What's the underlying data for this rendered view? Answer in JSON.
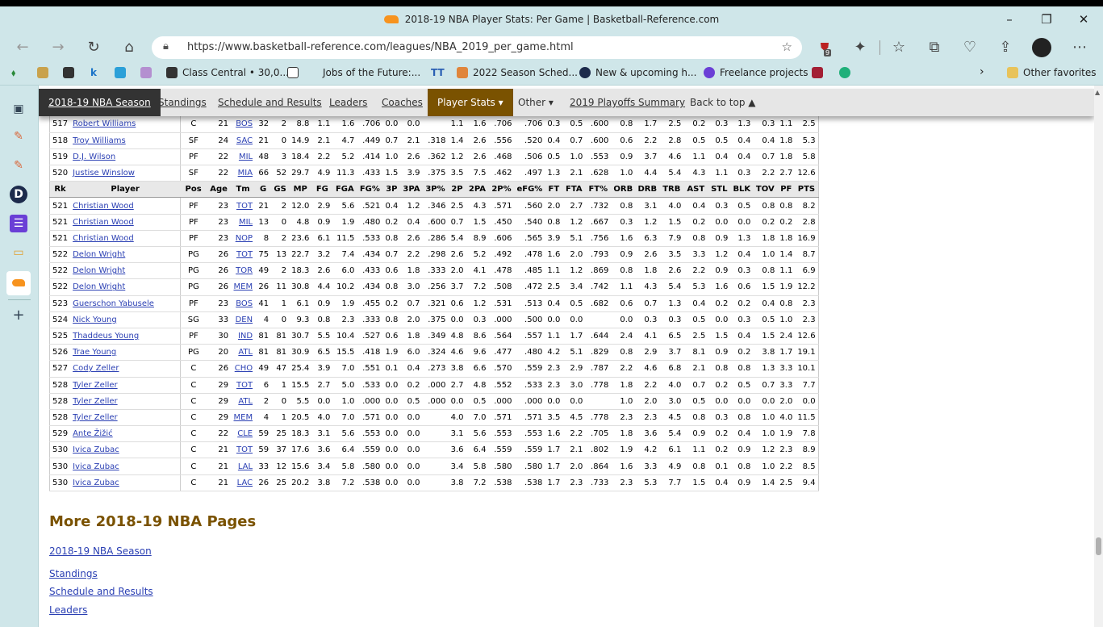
{
  "window": {
    "title": "2018-19 NBA Player Stats: Per Game | Basketball-Reference.com"
  },
  "browser": {
    "url": "https://www.basketball-reference.com/leagues/NBA_2019_per_game.html",
    "extension_badge": "9",
    "bookmarks": [
      {
        "label": "Class Central • 30,0...",
        "icon": "class-central-icon"
      },
      {
        "label": "Jobs of the Future:...",
        "icon": "document-icon"
      },
      {
        "label": "2022 Season Sched...",
        "icon": "pencil-icon"
      },
      {
        "label": "New & upcoming h...",
        "icon": "d-logo-icon"
      },
      {
        "label": "Freelance projects",
        "icon": "freelance-icon"
      }
    ],
    "other_favorites": "Other favorites"
  },
  "site_nav": {
    "items": [
      {
        "label": "2018-19 NBA Season"
      },
      {
        "label": "Standings"
      },
      {
        "label": "Schedule and Results"
      },
      {
        "label": "Leaders"
      },
      {
        "label": "Coaches"
      },
      {
        "label": "Player Stats ▾"
      },
      {
        "label": "Other ▾"
      },
      {
        "label": "2019 Playoffs Summary"
      },
      {
        "label": "Back to top ▲"
      }
    ]
  },
  "table": {
    "headers": [
      "Rk",
      "Player",
      "Pos",
      "Age",
      "Tm",
      "G",
      "GS",
      "MP",
      "FG",
      "FGA",
      "FG%",
      "3P",
      "3PA",
      "3P%",
      "2P",
      "2PA",
      "2P%",
      "eFG%",
      "FT",
      "FTA",
      "FT%",
      "ORB",
      "DRB",
      "TRB",
      "AST",
      "STL",
      "BLK",
      "TOV",
      "PF",
      "PTS"
    ],
    "rows_top": [
      [
        "517",
        "Robert Williams",
        "C",
        "21",
        "BOS",
        "32",
        "2",
        "8.8",
        "1.1",
        "1.6",
        ".706",
        "0.0",
        "0.0",
        "",
        "1.1",
        "1.6",
        ".706",
        ".706",
        "0.3",
        "0.5",
        ".600",
        "0.8",
        "1.7",
        "2.5",
        "0.2",
        "0.3",
        "1.3",
        "0.3",
        "1.1",
        "2.5"
      ],
      [
        "518",
        "Troy Williams",
        "SF",
        "24",
        "SAC",
        "21",
        "0",
        "14.9",
        "2.1",
        "4.7",
        ".449",
        "0.7",
        "2.1",
        ".318",
        "1.4",
        "2.6",
        ".556",
        ".520",
        "0.4",
        "0.7",
        ".600",
        "0.6",
        "2.2",
        "2.8",
        "0.5",
        "0.5",
        "0.4",
        "0.4",
        "1.8",
        "5.3"
      ],
      [
        "519",
        "D.J. Wilson",
        "PF",
        "22",
        "MIL",
        "48",
        "3",
        "18.4",
        "2.2",
        "5.2",
        ".414",
        "1.0",
        "2.6",
        ".362",
        "1.2",
        "2.6",
        ".468",
        ".506",
        "0.5",
        "1.0",
        ".553",
        "0.9",
        "3.7",
        "4.6",
        "1.1",
        "0.4",
        "0.4",
        "0.7",
        "1.8",
        "5.8"
      ],
      [
        "520",
        "Justise Winslow",
        "SF",
        "22",
        "MIA",
        "66",
        "52",
        "29.7",
        "4.9",
        "11.3",
        ".433",
        "1.5",
        "3.9",
        ".375",
        "3.5",
        "7.5",
        ".462",
        ".497",
        "1.3",
        "2.1",
        ".628",
        "1.0",
        "4.4",
        "5.4",
        "4.3",
        "1.1",
        "0.3",
        "2.2",
        "2.7",
        "12.6"
      ]
    ],
    "rows_bottom": [
      [
        "521",
        "Christian Wood",
        "PF",
        "23",
        "TOT",
        "21",
        "2",
        "12.0",
        "2.9",
        "5.6",
        ".521",
        "0.4",
        "1.2",
        ".346",
        "2.5",
        "4.3",
        ".571",
        ".560",
        "2.0",
        "2.7",
        ".732",
        "0.8",
        "3.1",
        "4.0",
        "0.4",
        "0.3",
        "0.5",
        "0.8",
        "0.8",
        "8.2"
      ],
      [
        "521",
        "Christian Wood",
        "PF",
        "23",
        "MIL",
        "13",
        "0",
        "4.8",
        "0.9",
        "1.9",
        ".480",
        "0.2",
        "0.4",
        ".600",
        "0.7",
        "1.5",
        ".450",
        ".540",
        "0.8",
        "1.2",
        ".667",
        "0.3",
        "1.2",
        "1.5",
        "0.2",
        "0.0",
        "0.0",
        "0.2",
        "0.2",
        "2.8"
      ],
      [
        "521",
        "Christian Wood",
        "PF",
        "23",
        "NOP",
        "8",
        "2",
        "23.6",
        "6.1",
        "11.5",
        ".533",
        "0.8",
        "2.6",
        ".286",
        "5.4",
        "8.9",
        ".606",
        ".565",
        "3.9",
        "5.1",
        ".756",
        "1.6",
        "6.3",
        "7.9",
        "0.8",
        "0.9",
        "1.3",
        "1.8",
        "1.8",
        "16.9"
      ],
      [
        "522",
        "Delon Wright",
        "PG",
        "26",
        "TOT",
        "75",
        "13",
        "22.7",
        "3.2",
        "7.4",
        ".434",
        "0.7",
        "2.2",
        ".298",
        "2.6",
        "5.2",
        ".492",
        ".478",
        "1.6",
        "2.0",
        ".793",
        "0.9",
        "2.6",
        "3.5",
        "3.3",
        "1.2",
        "0.4",
        "1.0",
        "1.4",
        "8.7"
      ],
      [
        "522",
        "Delon Wright",
        "PG",
        "26",
        "TOR",
        "49",
        "2",
        "18.3",
        "2.6",
        "6.0",
        ".433",
        "0.6",
        "1.8",
        ".333",
        "2.0",
        "4.1",
        ".478",
        ".485",
        "1.1",
        "1.2",
        ".869",
        "0.8",
        "1.8",
        "2.6",
        "2.2",
        "0.9",
        "0.3",
        "0.8",
        "1.1",
        "6.9"
      ],
      [
        "522",
        "Delon Wright",
        "PG",
        "26",
        "MEM",
        "26",
        "11",
        "30.8",
        "4.4",
        "10.2",
        ".434",
        "0.8",
        "3.0",
        ".256",
        "3.7",
        "7.2",
        ".508",
        ".472",
        "2.5",
        "3.4",
        ".742",
        "1.1",
        "4.3",
        "5.4",
        "5.3",
        "1.6",
        "0.6",
        "1.5",
        "1.9",
        "12.2"
      ],
      [
        "523",
        "Guerschon Yabusele",
        "PF",
        "23",
        "BOS",
        "41",
        "1",
        "6.1",
        "0.9",
        "1.9",
        ".455",
        "0.2",
        "0.7",
        ".321",
        "0.6",
        "1.2",
        ".531",
        ".513",
        "0.4",
        "0.5",
        ".682",
        "0.6",
        "0.7",
        "1.3",
        "0.4",
        "0.2",
        "0.2",
        "0.4",
        "0.8",
        "2.3"
      ],
      [
        "524",
        "Nick Young",
        "SG",
        "33",
        "DEN",
        "4",
        "0",
        "9.3",
        "0.8",
        "2.3",
        ".333",
        "0.8",
        "2.0",
        ".375",
        "0.0",
        "0.3",
        ".000",
        ".500",
        "0.0",
        "0.0",
        "",
        "0.0",
        "0.3",
        "0.3",
        "0.5",
        "0.0",
        "0.3",
        "0.5",
        "1.0",
        "2.3"
      ],
      [
        "525",
        "Thaddeus Young",
        "PF",
        "30",
        "IND",
        "81",
        "81",
        "30.7",
        "5.5",
        "10.4",
        ".527",
        "0.6",
        "1.8",
        ".349",
        "4.8",
        "8.6",
        ".564",
        ".557",
        "1.1",
        "1.7",
        ".644",
        "2.4",
        "4.1",
        "6.5",
        "2.5",
        "1.5",
        "0.4",
        "1.5",
        "2.4",
        "12.6"
      ],
      [
        "526",
        "Trae Young",
        "PG",
        "20",
        "ATL",
        "81",
        "81",
        "30.9",
        "6.5",
        "15.5",
        ".418",
        "1.9",
        "6.0",
        ".324",
        "4.6",
        "9.6",
        ".477",
        ".480",
        "4.2",
        "5.1",
        ".829",
        "0.8",
        "2.9",
        "3.7",
        "8.1",
        "0.9",
        "0.2",
        "3.8",
        "1.7",
        "19.1"
      ],
      [
        "527",
        "Cody Zeller",
        "C",
        "26",
        "CHO",
        "49",
        "47",
        "25.4",
        "3.9",
        "7.0",
        ".551",
        "0.1",
        "0.4",
        ".273",
        "3.8",
        "6.6",
        ".570",
        ".559",
        "2.3",
        "2.9",
        ".787",
        "2.2",
        "4.6",
        "6.8",
        "2.1",
        "0.8",
        "0.8",
        "1.3",
        "3.3",
        "10.1"
      ],
      [
        "528",
        "Tyler Zeller",
        "C",
        "29",
        "TOT",
        "6",
        "1",
        "15.5",
        "2.7",
        "5.0",
        ".533",
        "0.0",
        "0.2",
        ".000",
        "2.7",
        "4.8",
        ".552",
        ".533",
        "2.3",
        "3.0",
        ".778",
        "1.8",
        "2.2",
        "4.0",
        "0.7",
        "0.2",
        "0.5",
        "0.7",
        "3.3",
        "7.7"
      ],
      [
        "528",
        "Tyler Zeller",
        "C",
        "29",
        "ATL",
        "2",
        "0",
        "5.5",
        "0.0",
        "1.0",
        ".000",
        "0.0",
        "0.5",
        ".000",
        "0.0",
        "0.5",
        ".000",
        ".000",
        "0.0",
        "0.0",
        "",
        "1.0",
        "2.0",
        "3.0",
        "0.5",
        "0.0",
        "0.0",
        "0.0",
        "2.0",
        "0.0"
      ],
      [
        "528",
        "Tyler Zeller",
        "C",
        "29",
        "MEM",
        "4",
        "1",
        "20.5",
        "4.0",
        "7.0",
        ".571",
        "0.0",
        "0.0",
        "",
        "4.0",
        "7.0",
        ".571",
        ".571",
        "3.5",
        "4.5",
        ".778",
        "2.3",
        "2.3",
        "4.5",
        "0.8",
        "0.3",
        "0.8",
        "1.0",
        "4.0",
        "11.5"
      ],
      [
        "529",
        "Ante Žižić",
        "C",
        "22",
        "CLE",
        "59",
        "25",
        "18.3",
        "3.1",
        "5.6",
        ".553",
        "0.0",
        "0.0",
        "",
        "3.1",
        "5.6",
        ".553",
        ".553",
        "1.6",
        "2.2",
        ".705",
        "1.8",
        "3.6",
        "5.4",
        "0.9",
        "0.2",
        "0.4",
        "1.0",
        "1.9",
        "7.8"
      ],
      [
        "530",
        "Ivica Zubac",
        "C",
        "21",
        "TOT",
        "59",
        "37",
        "17.6",
        "3.6",
        "6.4",
        ".559",
        "0.0",
        "0.0",
        "",
        "3.6",
        "6.4",
        ".559",
        ".559",
        "1.7",
        "2.1",
        ".802",
        "1.9",
        "4.2",
        "6.1",
        "1.1",
        "0.2",
        "0.9",
        "1.2",
        "2.3",
        "8.9"
      ],
      [
        "530",
        "Ivica Zubac",
        "C",
        "21",
        "LAL",
        "33",
        "12",
        "15.6",
        "3.4",
        "5.8",
        ".580",
        "0.0",
        "0.0",
        "",
        "3.4",
        "5.8",
        ".580",
        ".580",
        "1.7",
        "2.0",
        ".864",
        "1.6",
        "3.3",
        "4.9",
        "0.8",
        "0.1",
        "0.8",
        "1.0",
        "2.2",
        "8.5"
      ],
      [
        "530",
        "Ivica Zubac",
        "C",
        "21",
        "LAC",
        "26",
        "25",
        "20.2",
        "3.8",
        "7.2",
        ".538",
        "0.0",
        "0.0",
        "",
        "3.8",
        "7.2",
        ".538",
        ".538",
        "1.7",
        "2.3",
        ".733",
        "2.3",
        "5.3",
        "7.7",
        "1.5",
        "0.4",
        "0.9",
        "1.4",
        "2.5",
        "9.4"
      ]
    ]
  },
  "more_pages": {
    "heading": "More 2018-19 NBA Pages",
    "links": [
      "2018-19 NBA Season",
      "Standings",
      "Schedule and Results",
      "Leaders"
    ]
  }
}
